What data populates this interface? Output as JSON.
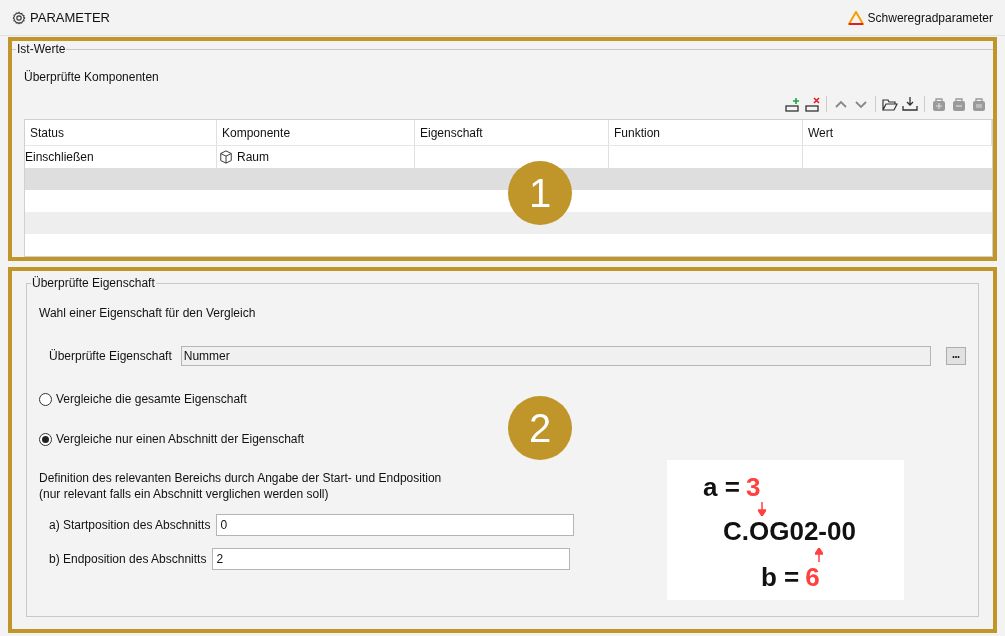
{
  "header": {
    "title": "PARAMETER",
    "link": "Schweregradparameter"
  },
  "section1": {
    "legend": "Ist-Werte",
    "heading": "Überprüfte Komponenten",
    "badge": "1",
    "toolbar": [
      {
        "kind": "add",
        "disabled": false
      },
      {
        "kind": "remove",
        "disabled": false
      },
      {
        "kind": "sep"
      },
      {
        "kind": "up",
        "disabled": false
      },
      {
        "kind": "down",
        "disabled": false
      },
      {
        "kind": "sep"
      },
      {
        "kind": "open",
        "disabled": false
      },
      {
        "kind": "download",
        "disabled": false
      },
      {
        "kind": "sep"
      },
      {
        "kind": "bag-plus",
        "disabled": true
      },
      {
        "kind": "bag-minus",
        "disabled": true
      },
      {
        "kind": "bag-equal",
        "disabled": true
      }
    ],
    "table": {
      "columns": [
        "Status",
        "Komponente",
        "Eigenschaft",
        "Funktion",
        "Wert"
      ],
      "rows": [
        {
          "status": "Einschließen",
          "component": "Raum"
        }
      ]
    }
  },
  "section2": {
    "legend": "Überprüfte Eigenschaft",
    "badge": "2",
    "intro": "Wahl einer Eigenschaft für den Vergleich",
    "property": {
      "label": "Überprüfte Eigenschaft",
      "value": "Nummer",
      "button": "•••"
    },
    "options": [
      {
        "label": "Vergleiche die gesamte Eigenschaft",
        "selected": false
      },
      {
        "label": "Vergleiche nur einen Abschnitt der Eigenschaft",
        "selected": true
      }
    ],
    "definition": [
      "Definition des relevanten Bereichs durch Angabe der Start- und Endposition",
      "(nur relevant falls ein Abschnitt verglichen werden soll)"
    ],
    "fields": [
      {
        "label": "a) Startposition des Abschnitts",
        "value": "0"
      },
      {
        "label": "b) Endposition des Abschnitts",
        "value": "2"
      }
    ],
    "figure": {
      "a_label": "a =",
      "a_value": "3",
      "code": "C.OG02-00",
      "b_label": "b =",
      "b_value": "6"
    }
  }
}
